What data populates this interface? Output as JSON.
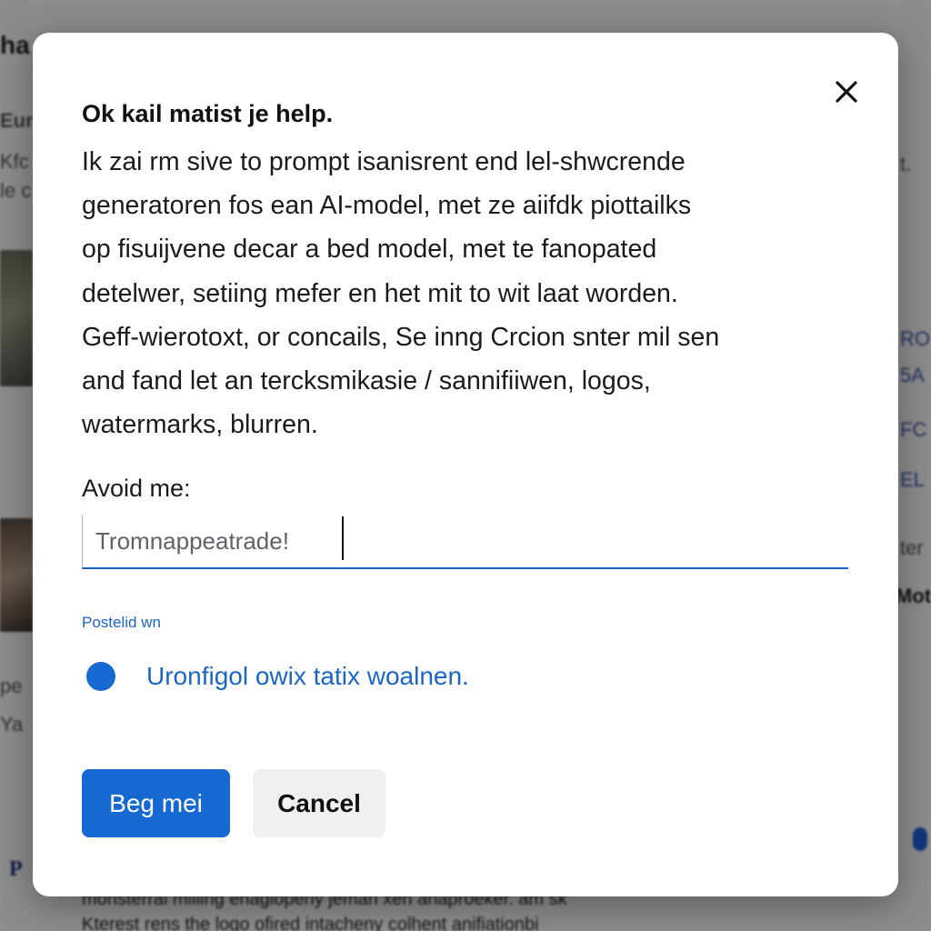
{
  "background": {
    "heading": "ha",
    "left_lines": [
      "Euri",
      "Kfc",
      "le c",
      "pe",
      "Ya"
    ],
    "right_lines": [
      "t.",
      "RO",
      "5A",
      "FC",
      "EL",
      "ter",
      "Mot"
    ],
    "bottom_lines": [
      "monsterrai milling enagiopeny jeman xen anaproeker. am sk",
      "Kterest rens the logo ofired intacheny colhent anifiationbi"
    ],
    "p_glyph": "P"
  },
  "dialog": {
    "title": "Ok kail matist je help.",
    "body_lines": [
      "Ik zai rm sive to prompt isanisrent end lel-shwcrende",
      "generatoren fos ean AI-model, met ze aiifdk piottailks",
      "op fisuijvene decar a bed model, met te fanopated",
      "detelwer, setiing mefer en het mit to wit laat worden.",
      "Geff-wierotoxt, or concails, Se inng Crcion snter mil sen",
      "and fand let an tercksmikasie / sannifiiwen, logos,",
      "watermarks, blurren."
    ],
    "field_label": "Avoid me:",
    "input_value": "Tromnappeatrade!",
    "helper_link": "Postelid wn",
    "radio_label": "Uronfigol owix tatix woalnen.",
    "primary_button": "Beg mei",
    "cancel_button": "Cancel"
  },
  "colors": {
    "accent": "#1769d2",
    "link": "#1a66c4",
    "overlay": "rgba(0,0,0,0.42)"
  },
  "icons": {
    "close": "close-icon"
  }
}
